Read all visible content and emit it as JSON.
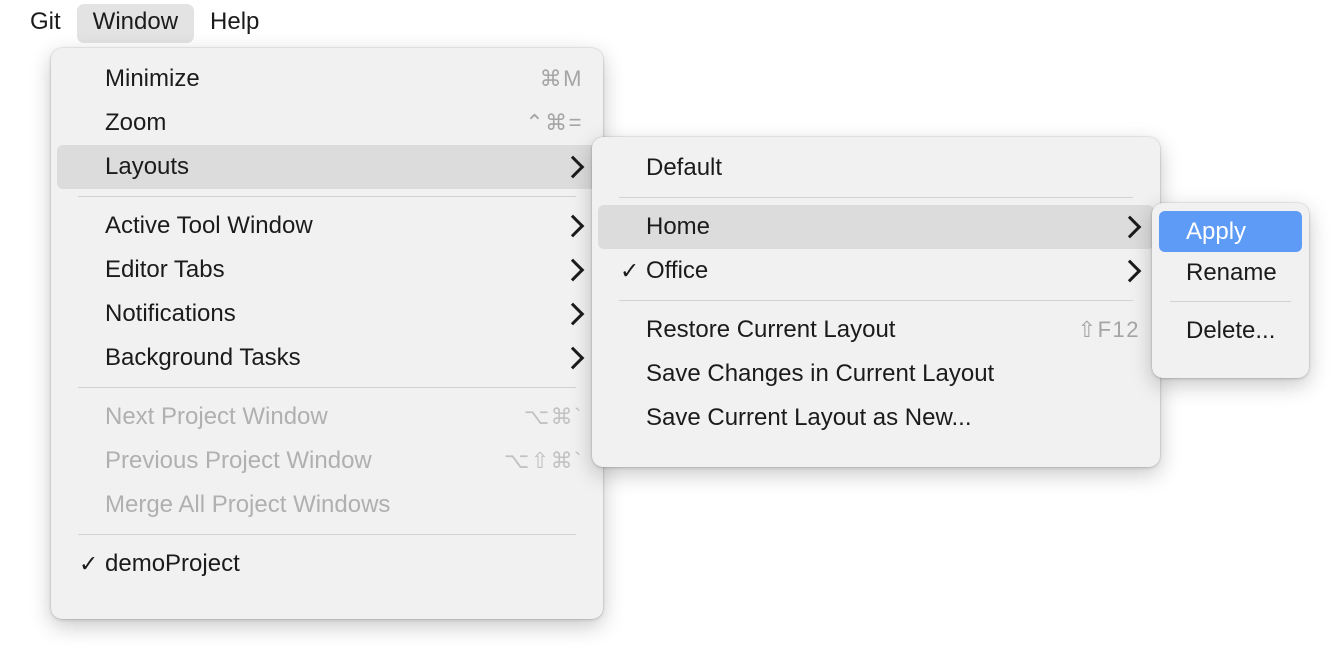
{
  "menubar": {
    "items": [
      {
        "label": "Git",
        "active": false
      },
      {
        "label": "Window",
        "active": true
      },
      {
        "label": "Help",
        "active": false
      }
    ]
  },
  "window_menu": {
    "items": [
      {
        "label": "Minimize",
        "shortcut": "⌘M"
      },
      {
        "label": "Zoom",
        "shortcut": "⌃⌘="
      },
      {
        "label": "Layouts",
        "submenu_arrow": "›"
      },
      {
        "label": "Active Tool Window",
        "submenu_arrow": "›"
      },
      {
        "label": "Editor Tabs",
        "submenu_arrow": "›"
      },
      {
        "label": "Notifications",
        "submenu_arrow": "›"
      },
      {
        "label": "Background Tasks",
        "submenu_arrow": "›"
      },
      {
        "label": "Next Project Window",
        "shortcut": "⌥⌘`"
      },
      {
        "label": "Previous Project Window",
        "shortcut": "⌥⇧⌘`"
      },
      {
        "label": "Merge All Project Windows",
        "shortcut": ""
      },
      {
        "label": "demoProject",
        "check": "✓"
      }
    ]
  },
  "layouts_menu": {
    "items": [
      {
        "label": "Default"
      },
      {
        "label": "Home",
        "submenu_arrow": "›"
      },
      {
        "label": "Office",
        "check": "✓",
        "submenu_arrow": "›"
      },
      {
        "label": "Restore Current Layout",
        "shortcut": "⇧F12"
      },
      {
        "label": "Save Changes in Current Layout"
      },
      {
        "label": "Save Current Layout as New..."
      }
    ]
  },
  "layout_actions_menu": {
    "items": [
      {
        "label": "Apply"
      },
      {
        "label": "Rename"
      },
      {
        "label": "Delete..."
      }
    ]
  },
  "colors": {
    "selection_blue": "#5d9bf6",
    "hover_grey": "#dcdcdc",
    "panel_bg": "#f1f1f1",
    "text": "#1b1b1b",
    "disabled_text": "#b0b0b0",
    "shortcut_text": "#a5a5a5"
  }
}
